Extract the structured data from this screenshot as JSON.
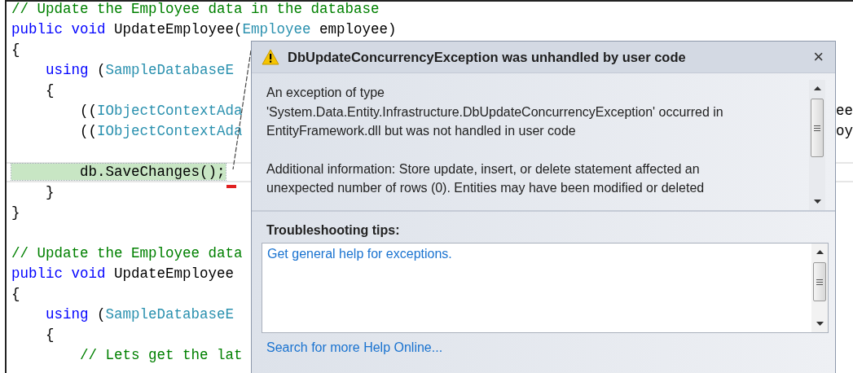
{
  "editor": {
    "lines": [
      {
        "current": false,
        "segments": [
          {
            "kind": "comment",
            "text": "// Update the Employee data in the database"
          }
        ]
      },
      {
        "current": false,
        "segments": [
          {
            "kind": "keyword",
            "text": "public void "
          },
          {
            "kind": "plain",
            "text": "UpdateEmployee("
          },
          {
            "kind": "type",
            "text": "Employee"
          },
          {
            "kind": "plain",
            "text": " employee)"
          }
        ]
      },
      {
        "current": false,
        "segments": [
          {
            "kind": "plain",
            "text": "{"
          }
        ]
      },
      {
        "current": false,
        "segments": [
          {
            "kind": "keyword",
            "text": "    using"
          },
          {
            "kind": "plain",
            "text": " ("
          },
          {
            "kind": "type",
            "text": "SampleDatabaseE"
          }
        ]
      },
      {
        "current": false,
        "segments": [
          {
            "kind": "plain",
            "text": "    {"
          }
        ]
      },
      {
        "current": false,
        "segments": [
          {
            "kind": "plain",
            "text": "        (("
          },
          {
            "kind": "type",
            "text": "IObjectContextAda"
          }
        ],
        "right": "ee"
      },
      {
        "current": false,
        "segments": [
          {
            "kind": "plain",
            "text": "        (("
          },
          {
            "kind": "type",
            "text": "IObjectContextAda"
          }
        ],
        "right": "oy"
      },
      {
        "current": false
      },
      {
        "current": true,
        "segments": [
          {
            "kind": "highlight",
            "text": "        db.SaveChanges();"
          }
        ]
      },
      {
        "current": false,
        "segments": [
          {
            "kind": "plain",
            "text": "    }"
          }
        ]
      },
      {
        "current": false,
        "segments": [
          {
            "kind": "plain",
            "text": "}"
          }
        ]
      },
      {
        "current": false
      },
      {
        "current": false,
        "segments": [
          {
            "kind": "comment",
            "text": "// Update the Employee data"
          }
        ]
      },
      {
        "current": false,
        "segments": [
          {
            "kind": "keyword",
            "text": "public void "
          },
          {
            "kind": "plain",
            "text": "UpdateEmployee"
          }
        ]
      },
      {
        "current": false,
        "segments": [
          {
            "kind": "plain",
            "text": "{"
          }
        ]
      },
      {
        "current": false,
        "segments": [
          {
            "kind": "keyword",
            "text": "    using"
          },
          {
            "kind": "plain",
            "text": " ("
          },
          {
            "kind": "type",
            "text": "SampleDatabaseE"
          }
        ]
      },
      {
        "current": false,
        "segments": [
          {
            "kind": "plain",
            "text": "    {"
          }
        ]
      },
      {
        "current": false,
        "segments": [
          {
            "kind": "comment",
            "text": "        // Lets get the lat"
          }
        ]
      }
    ]
  },
  "exception_popup": {
    "title": "DbUpdateConcurrencyException was unhandled by user code",
    "close": "×",
    "message": [
      "An exception of type 'System.Data.Entity.Infrastructure.DbUpdateConcurrencyException' occurred in EntityFramework.dll but was not handled in user code",
      "Additional information: Store update, insert, or delete statement affected an unexpected number of rows (0). Entities may have been modified or deleted"
    ],
    "tips_heading": "Troubleshooting tips:",
    "tips": [
      "Get general help for exceptions."
    ],
    "footer_link": "Search for more Help Online..."
  }
}
